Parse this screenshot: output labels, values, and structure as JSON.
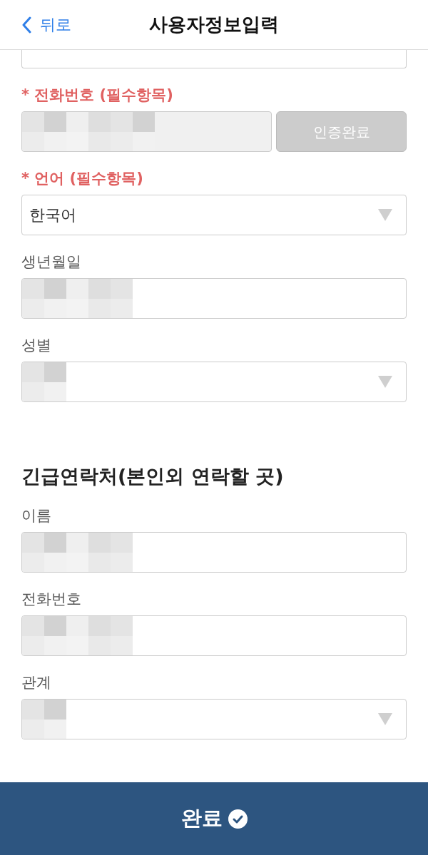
{
  "header": {
    "back_label": "뒤로",
    "title": "사용자정보입력"
  },
  "sections": [
    {
      "fields": [
        {
          "kind": "input",
          "cut": true,
          "disabled": false
        },
        {
          "kind": "verify",
          "required": true,
          "required_mark": "*",
          "label": "전화번호 (필수항목)",
          "redacted": true,
          "disabled": true,
          "button": {
            "label": "인증완료",
            "disabled": true
          }
        },
        {
          "kind": "select",
          "required": true,
          "required_mark": "*",
          "label": "언어 (필수항목)",
          "value": "한국어"
        },
        {
          "kind": "input",
          "required": false,
          "label": "생년월일",
          "redacted": true,
          "disabled": false
        },
        {
          "kind": "select",
          "required": false,
          "label": "성별",
          "redacted": true
        }
      ]
    },
    {
      "heading": "긴급연락처(본인외 연락할 곳)",
      "fields": [
        {
          "kind": "input",
          "required": false,
          "label": "이름",
          "redacted": true,
          "disabled": false
        },
        {
          "kind": "input",
          "required": false,
          "label": "전화번호",
          "redacted": true,
          "disabled": false
        },
        {
          "kind": "select",
          "required": false,
          "label": "관계",
          "redacted": true
        }
      ]
    }
  ],
  "footer": {
    "label": "완료"
  }
}
